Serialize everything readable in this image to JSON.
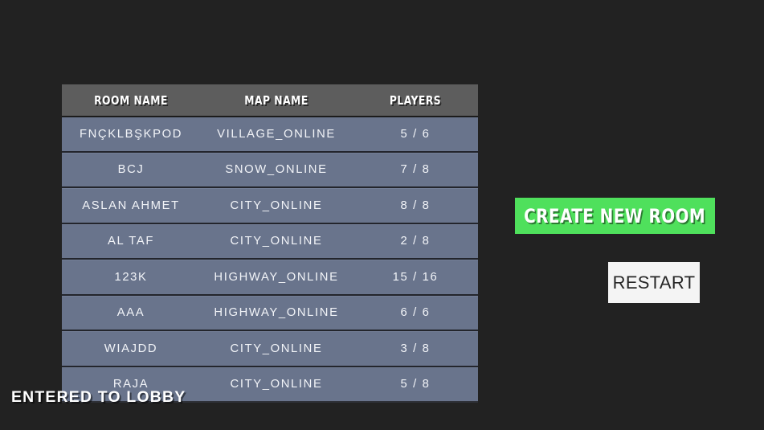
{
  "background_color": "#222222",
  "room_list": {
    "columns": [
      {
        "key": "room_name",
        "label": "ROOM NAME"
      },
      {
        "key": "map_name",
        "label": "MAP NAME"
      },
      {
        "key": "players",
        "label": "PLAYERS"
      }
    ],
    "header_background": "#5d5d5d",
    "row_background": "#69748c",
    "rows": [
      {
        "room_name": "FNÇKLBŞKPOD",
        "map_name": "VILLAGE_ONLINE",
        "players": "5 / 6"
      },
      {
        "room_name": "BCJ",
        "map_name": "SNOW_ONLINE",
        "players": "7 / 8"
      },
      {
        "room_name": "ASLAN AHMET",
        "map_name": "CITY_ONLINE",
        "players": "8 / 8"
      },
      {
        "room_name": "AL TAF",
        "map_name": "CITY_ONLINE",
        "players": "2 / 8"
      },
      {
        "room_name": "123K",
        "map_name": "HIGHWAY_ONLINE",
        "players": "15 / 16"
      },
      {
        "room_name": "AAA",
        "map_name": "HIGHWAY_ONLINE",
        "players": "6 / 6"
      },
      {
        "room_name": "WIAJDD",
        "map_name": "CITY_ONLINE",
        "players": "3 / 8"
      },
      {
        "room_name": "RAJA",
        "map_name": "CITY_ONLINE",
        "players": "5 / 8"
      }
    ]
  },
  "actions": {
    "create_new_room_label": "CREATE NEW ROOM",
    "create_new_room_color": "#4fe05c",
    "restart_label": "RESTART",
    "restart_color": "#f4f4f4"
  },
  "status": {
    "message": "ENTERED TO LOBBY"
  }
}
